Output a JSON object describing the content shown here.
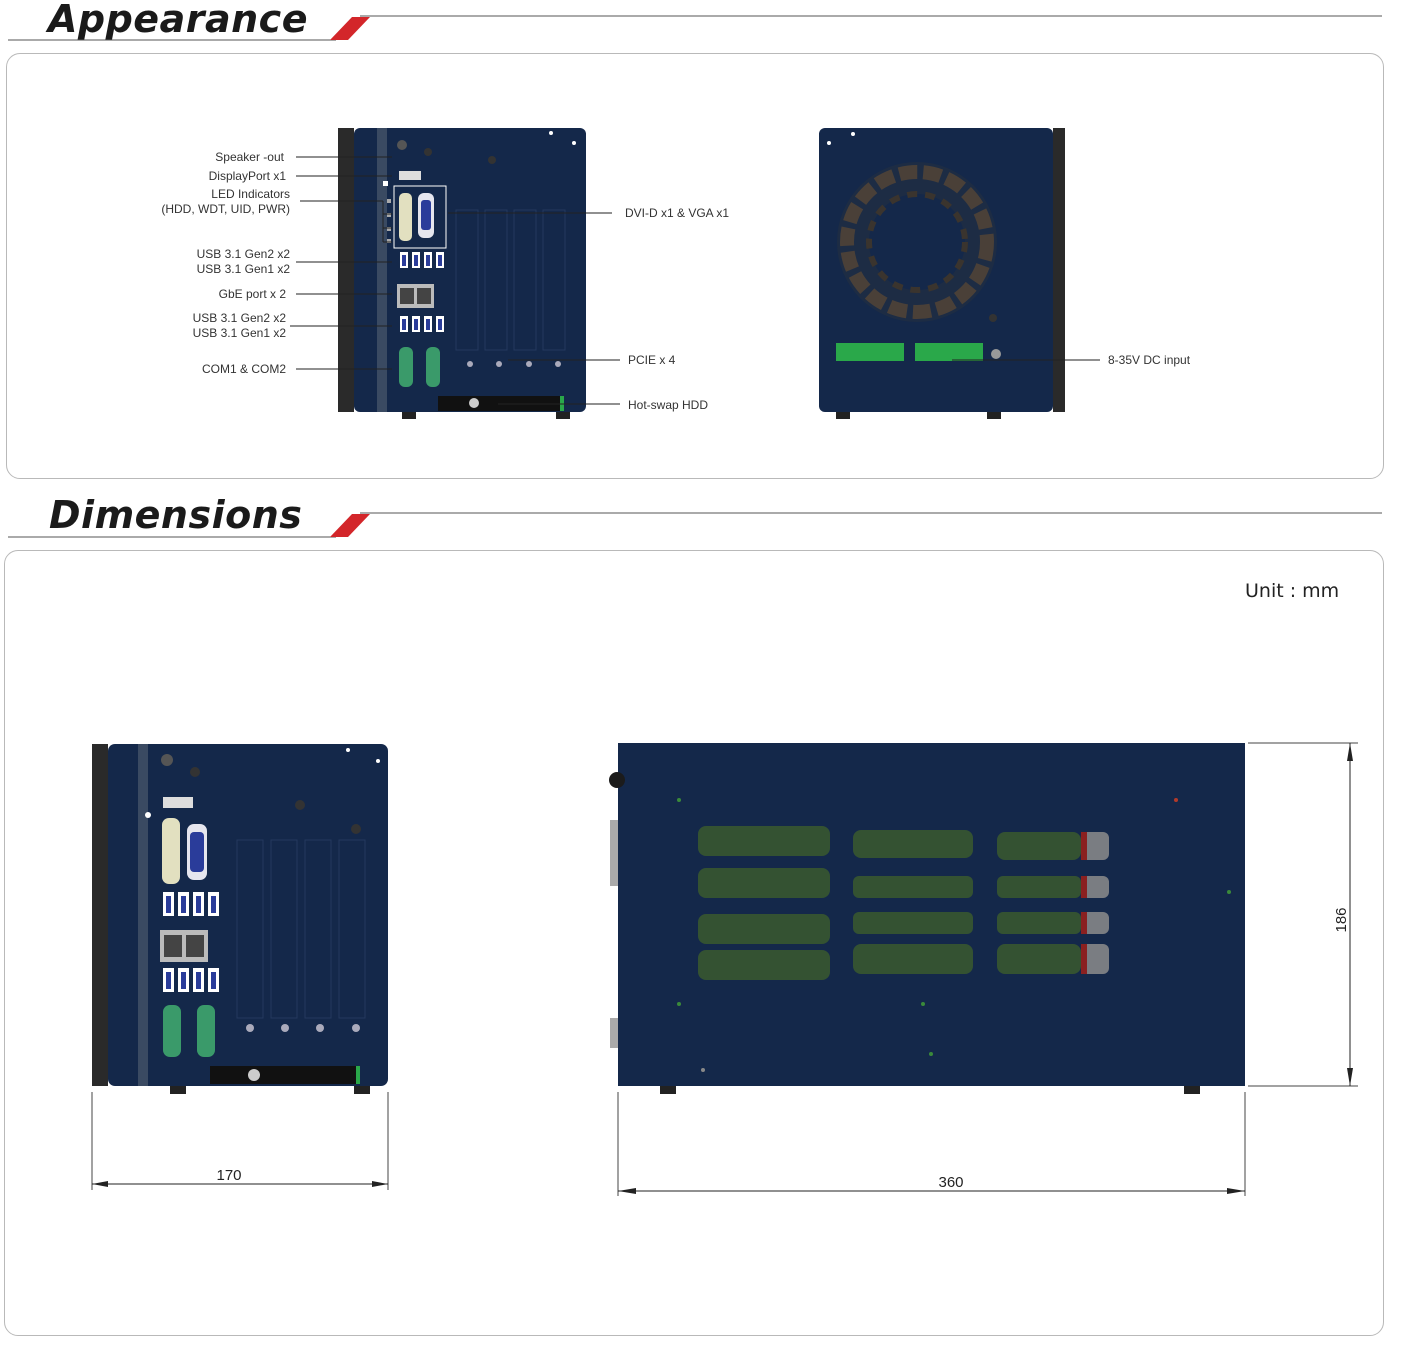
{
  "appearance": {
    "title": "Appearance",
    "front_labels": [
      "Speaker -out",
      "DisplayPort x1",
      "LED Indicators",
      "(HDD, WDT, UID, PWR)",
      "USB 3.1 Gen2 x2",
      "USB 3.1 Gen1 x2",
      "GbE port x 2",
      "USB 3.1 Gen2 x2",
      "USB 3.1 Gen1 x2",
      "COM1 & COM2"
    ],
    "right_labels": [
      "DVI-D x1 & VGA x1",
      "PCIE x 4",
      "Hot-swap HDD"
    ],
    "rear_label": "8-35V DC input"
  },
  "dimensions": {
    "title": "Dimensions",
    "unit": "Unit : mm",
    "width": "170",
    "length": "360",
    "height": "186"
  },
  "colors": {
    "chassis": "#14284a",
    "accent_red": "#d3262a",
    "terminal_green": "#2aa84a",
    "com_green": "#3a9a6a"
  }
}
